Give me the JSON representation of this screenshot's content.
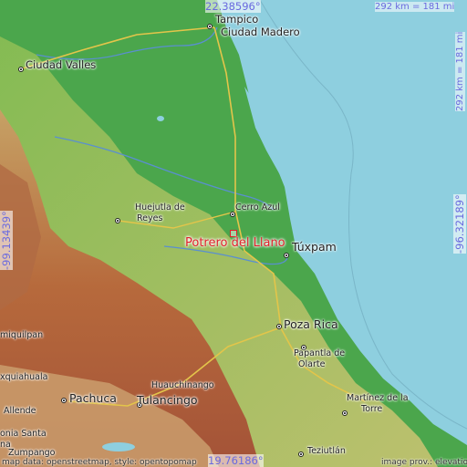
{
  "coords": {
    "top_lat": "22.38596°",
    "bottom_lat": "19.76186°",
    "left_lon": "-99.13439°",
    "right_lon": "-96.32189°"
  },
  "scale": {
    "horizontal": "292 km = 181 mi",
    "vertical": "292 km = 181 mi"
  },
  "target": {
    "name": "Potrero del Llano",
    "color": "#e0202a"
  },
  "cities": {
    "tampico": "Tampico",
    "ciudad_madero": "Ciudad Madero",
    "ciudad_valles": "Ciudad Valles",
    "huejutla_1": "Huejutla de",
    "huejutla_2": "Reyes",
    "cerro_azul": "Cerro Azul",
    "tuxpam": "Túxpam",
    "poza_rica": "Poza Rica",
    "papantla_1": "Papantla de",
    "papantla_2": "Olarte",
    "huauchinango": "Huauchinango",
    "pachuca": "Pachuca",
    "tulancingo": "Tulancingo",
    "martinez_1": "Martínez de la",
    "martinez_2": "Torre",
    "teziutlan": "Teziutlán",
    "ixmiquilpan": "miquilpan",
    "ixquiahuala": "xquiahuala",
    "allende": "Allende",
    "tizayuca_santa": "onia Santa",
    "tizayuca_ana": "na",
    "zumpango": "Zumpango"
  },
  "credits": {
    "left": "map data: openstreetmap, style: opentopomap",
    "right": "image prov.: elevation.city"
  },
  "colors": {
    "sea": "#8ecfdf",
    "lowland": "#4aa24a",
    "hills": "#b7c86a",
    "mountains": "#b8653a"
  }
}
